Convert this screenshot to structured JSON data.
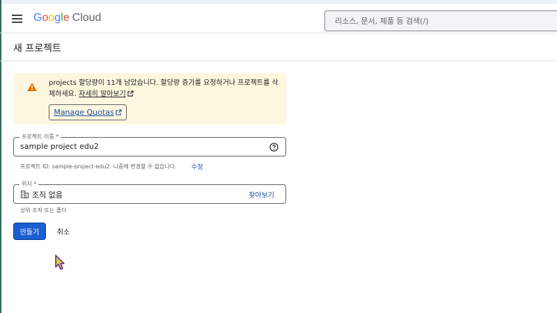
{
  "header": {
    "logo_google": "Google",
    "logo_cloud": "Cloud",
    "search_placeholder": "리소스, 문서, 제품 등 검색(/)"
  },
  "page": {
    "title": "새 프로젝트"
  },
  "alert": {
    "text": "projects 할당량이 11개 남았습니다. 할당량 증가를 요청하거나 프로젝트를 삭제하세요.",
    "link_label": "자세히 알아보기",
    "button_label": "Manage Quotas",
    "icon": "warning-icon",
    "background": "#fef7e0",
    "icon_color": "#e37400"
  },
  "project_name": {
    "label": "프로젝트 이름 *",
    "value": "sample project edu2",
    "hint": "프로젝트 ID: sample-project-edu2. 나중에 변경할 수 없습니다.",
    "edit_label": "수정"
  },
  "location": {
    "label": "위치 *",
    "value": "조직 없음",
    "browse_label": "찾아보기",
    "hint": "상위 조직 또는 폴더"
  },
  "actions": {
    "create_label": "만들기",
    "cancel_label": "취소",
    "primary_color": "#1a5fd1"
  }
}
